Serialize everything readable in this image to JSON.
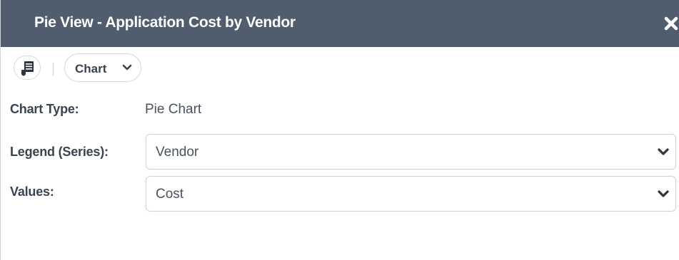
{
  "dialog": {
    "title": "Pie View - Application Cost by Vendor",
    "close_icon": "close-icon"
  },
  "toolbar": {
    "icon_button_icon": "report-list-icon",
    "view_dropdown_label": "Chart",
    "view_dropdown_icon": "chevron-down-icon"
  },
  "form": {
    "chart_type": {
      "label": "Chart Type:",
      "value": "Pie Chart"
    },
    "legend": {
      "label": "Legend (Series):",
      "value": "Vendor"
    },
    "values": {
      "label": "Values:",
      "value": "Cost"
    }
  },
  "colors": {
    "titlebar_bg": "#505d6e",
    "titlebar_text": "#ffffff",
    "label_text": "#3a4350",
    "value_text": "#4a525d",
    "border": "#cdd1d6"
  }
}
